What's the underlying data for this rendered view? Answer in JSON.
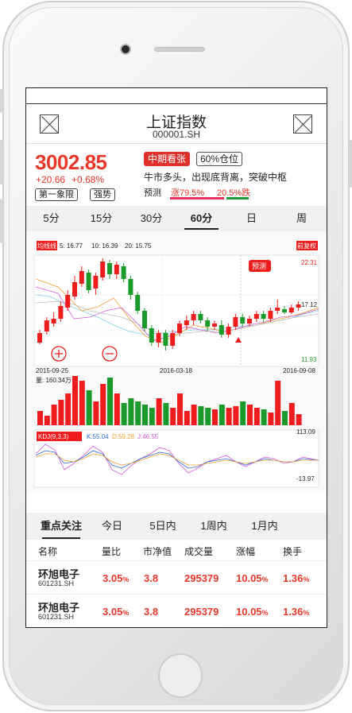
{
  "header": {
    "title": "上证指数",
    "code": "000001.SH"
  },
  "quote": {
    "price": "3002.85",
    "change": "+20.66",
    "change_pct": "+0.68%",
    "tag1": "第一象限",
    "tag2": "强势",
    "signal": "中期看张",
    "position": "60%仓位",
    "description": "牛市多头，出现底背离，突破中枢",
    "predict_label": "预测",
    "predict_up": "涨79.5%",
    "predict_down": "20.5%跌"
  },
  "period_tabs": [
    "5分",
    "15分",
    "30分",
    "60分",
    "日",
    "周"
  ],
  "active_period": "60分",
  "chart_data": {
    "type": "candlestick",
    "ma_label": "均线线",
    "ma5": "5: 16.77",
    "ma10": "10: 16.39",
    "ma20": "20: 15.75",
    "restore_label": "前复权",
    "predict_badge": "预测",
    "price_high": "22.31",
    "price_mid": "17.12",
    "price_low": "11.93",
    "dates": [
      "2015-09-25",
      "2016-03-18",
      "2016-09-08"
    ],
    "volume_label": "量: 160.34万",
    "volume_max": "113.09",
    "kdj_label": "KDJ(9,3,3)",
    "kdj_k": "K:55.04",
    "kdj_d": "D:59.28",
    "kdj_j": "J:46.55",
    "kdj_min": "-13.97",
    "up_color": "#ee1c1c",
    "down_color": "#1a9a2a"
  },
  "bottom_tabs": [
    "重点关注",
    "今日",
    "5日内",
    "1周内",
    "1月内"
  ],
  "table": {
    "headers": [
      "名称",
      "量比",
      "市净值",
      "成交量",
      "涨幅",
      "换手"
    ],
    "rows": [
      {
        "name": "环旭电子",
        "code": "601231.SH",
        "vol_ratio": "3.05",
        "pb": "3.8",
        "volume": "295379",
        "change": "10.05",
        "turnover": "1.36",
        "pct": "%"
      },
      {
        "name": "环旭电子",
        "code": "601231.SH",
        "vol_ratio": "3.05",
        "pb": "3.8",
        "volume": "295379",
        "change": "10.05",
        "turnover": "1.36",
        "pct": "%"
      }
    ]
  }
}
